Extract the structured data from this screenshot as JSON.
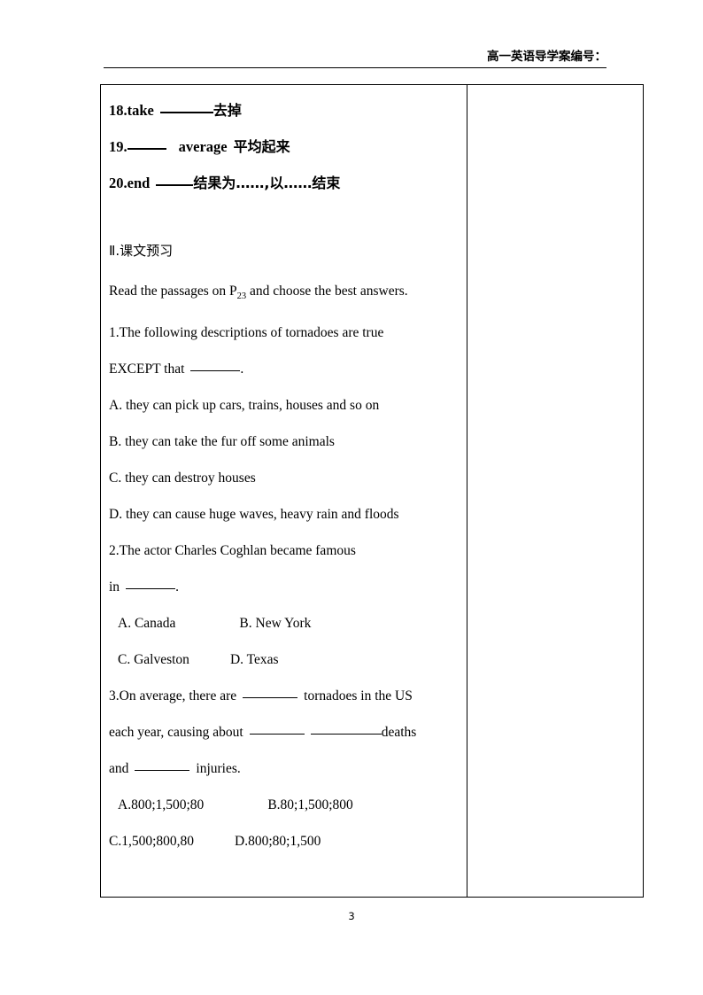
{
  "header": {
    "running_title": "高一英语导学案编号："
  },
  "vocabulary": {
    "items": [
      {
        "number": "18.",
        "word": "take",
        "blank_width": "w60",
        "meaning": "去掉"
      },
      {
        "number": "19.",
        "word": "average",
        "blank_width": "w44",
        "meaning": "平均起来"
      },
      {
        "number": "20.",
        "word": "end",
        "blank_width": "w42",
        "meaning": "结果为……,以……结束"
      }
    ]
  },
  "section": {
    "heading": "Ⅱ.课文预习",
    "instruction_before": "Read the passages on P",
    "instruction_sub": "23",
    "instruction_after": " and choose the best answers."
  },
  "questions": [
    {
      "stem_line1": "1.The following descriptions of tornadoes are true",
      "stem_line2_before": "EXCEPT that",
      "stem_line2_after": ".",
      "options": [
        "A. they can pick up cars, trains, houses and so on",
        "B. they can take the fur off some animals",
        "C. they can destroy houses",
        "D. they can cause huge waves, heavy rain and floods"
      ]
    },
    {
      "stem_line1": "2.The actor Charles Coghlan became famous",
      "stem_line2_before": "in",
      "stem_line2_after": ".",
      "option_rows": [
        {
          "left": "A. Canada",
          "right": "B. New York"
        },
        {
          "left": "C. Galveston",
          "right": "D. Texas"
        }
      ]
    },
    {
      "stem_part1": "3.On average, there are",
      "stem_part2": "tornadoes in the US",
      "stem_part3": "each year, causing about",
      "stem_part4": "deaths",
      "stem_part5": "and",
      "stem_part6": "injuries.",
      "option_rows": [
        {
          "left": "A.800;1,500;80",
          "right": "B.80;1,500;800"
        },
        {
          "left": "C.1,500;800,80",
          "right": "D.800;80;1,500"
        }
      ]
    }
  ],
  "footer": {
    "page_number": "3"
  }
}
